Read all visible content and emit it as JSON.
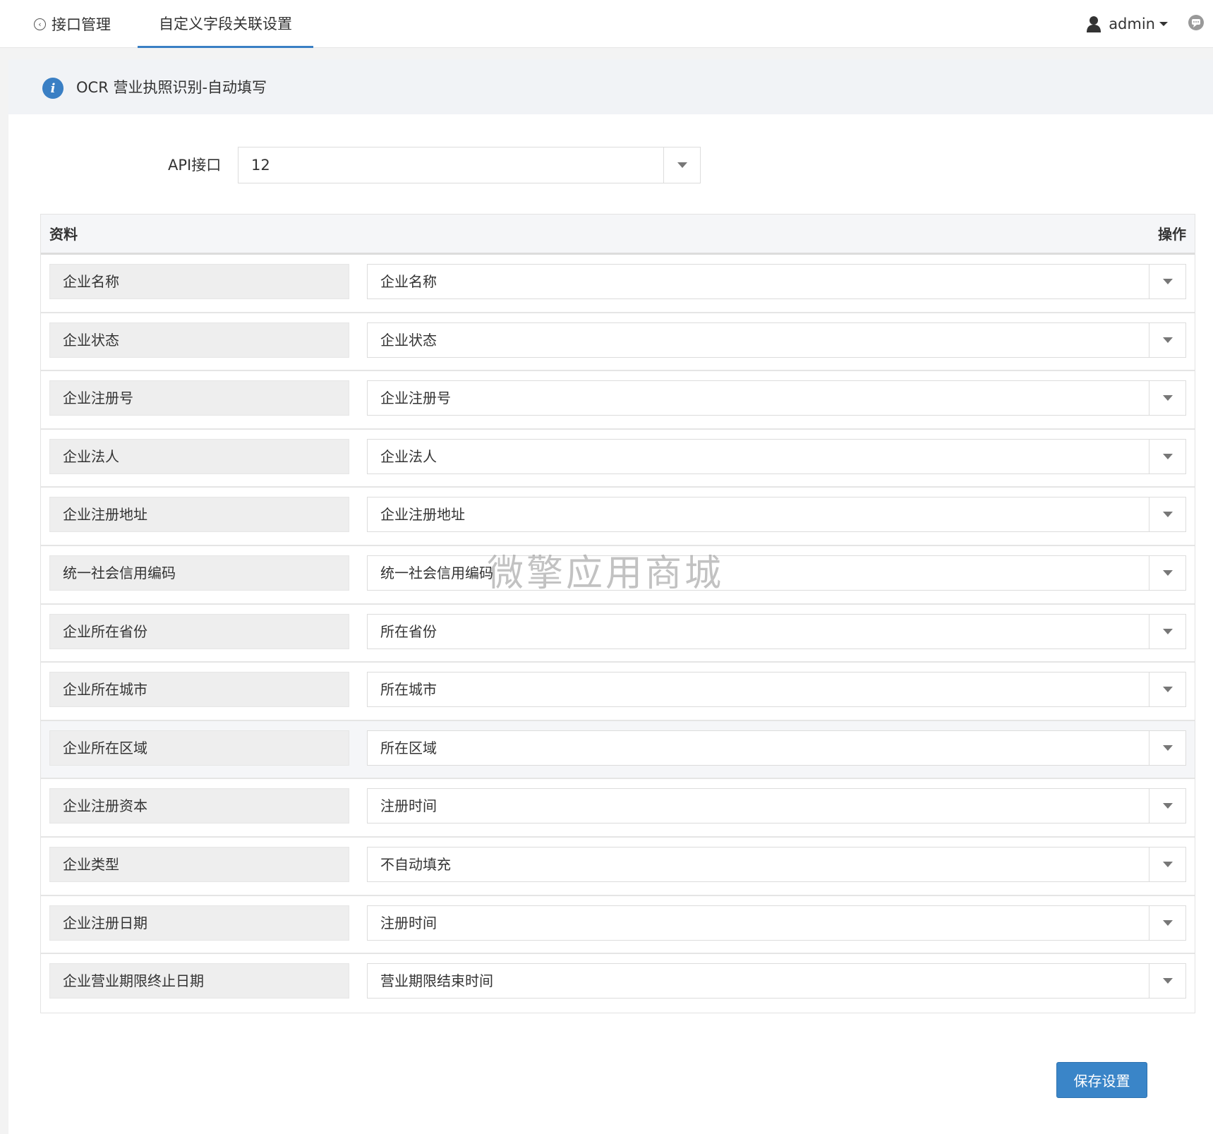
{
  "topbar": {
    "back_tab_label": "接口管理",
    "active_tab_label": "自定义字段关联设置",
    "user_name": "admin"
  },
  "notice": {
    "text": "OCR 营业执照识别-自动填写",
    "icon_char": "i"
  },
  "api": {
    "label": "API接口",
    "value": "12"
  },
  "table": {
    "header_left": "资料",
    "header_right": "操作",
    "rows": [
      {
        "name": "企业名称",
        "value": "企业名称"
      },
      {
        "name": "企业状态",
        "value": "企业状态"
      },
      {
        "name": "企业注册号",
        "value": "企业注册号"
      },
      {
        "name": "企业法人",
        "value": "企业法人"
      },
      {
        "name": "企业注册地址",
        "value": "企业注册地址"
      },
      {
        "name": "统一社会信用编码",
        "value": "统一社会信用编码"
      },
      {
        "name": "企业所在省份",
        "value": "所在省份"
      },
      {
        "name": "企业所在城市",
        "value": "所在城市"
      },
      {
        "name": "企业所在区域",
        "value": "所在区域"
      },
      {
        "name": "企业注册资本",
        "value": "注册时间"
      },
      {
        "name": "企业类型",
        "value": "不自动填充"
      },
      {
        "name": "企业注册日期",
        "value": "注册时间"
      },
      {
        "name": "企业营业期限终止日期",
        "value": "营业期限结束时间"
      }
    ]
  },
  "watermark": "微擎应用商城",
  "save_button": "保存设置",
  "colors": {
    "accent": "#3a7fc4",
    "button": "#3a85c8"
  }
}
